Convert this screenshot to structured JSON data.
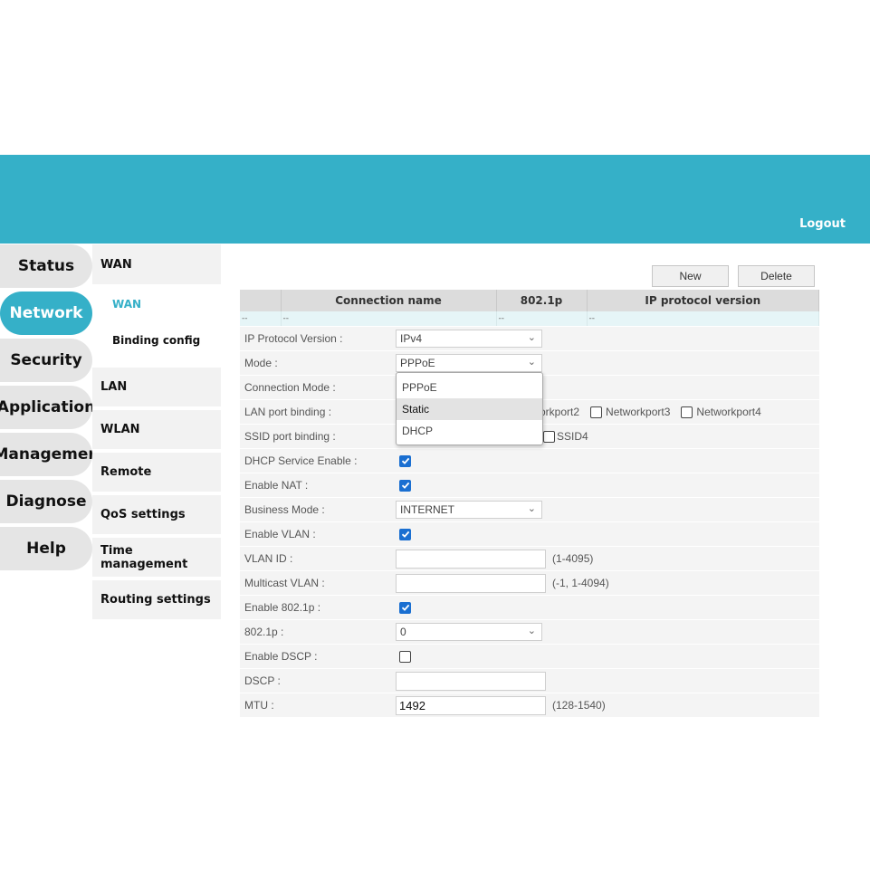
{
  "header": {
    "logout": "Logout"
  },
  "mainnav": [
    "Status",
    "Network",
    "Security",
    "Application",
    "Managemen",
    "Diagnose",
    "Help"
  ],
  "subnav": {
    "wan": "WAN",
    "wan_sub": [
      "WAN",
      "Binding config"
    ],
    "others": [
      "LAN",
      "WLAN",
      "Remote",
      "QoS settings",
      "Time management",
      "Routing settings"
    ]
  },
  "buttons": {
    "new": "New",
    "delete": "Delete"
  },
  "table": {
    "headers": [
      "",
      "Connection name",
      "802.1p",
      "IP protocol version"
    ],
    "row": [
      "--",
      "--",
      "--",
      "--"
    ]
  },
  "form": {
    "ip_protocol_label": "IP Protocol Version :",
    "ip_protocol_value": "IPv4",
    "mode_label": "Mode :",
    "mode_value": "PPPoE",
    "connection_mode_label": "Connection Mode :",
    "lan_binding_label": "LAN port binding :",
    "lan_ports": [
      "orkport2",
      "Networkport3",
      "Networkport4"
    ],
    "ssid_binding_label": "SSID port binding :",
    "ssid_port": "SSID4",
    "dhcp_label": "DHCP Service Enable :",
    "nat_label": "Enable NAT :",
    "business_mode_label": "Business Mode :",
    "business_mode_value": "INTERNET",
    "vlan_enable_label": "Enable VLAN :",
    "vlan_id_label": "VLAN ID :",
    "vlan_id_hint": "(1-4095)",
    "multicast_label": "Multicast VLAN :",
    "multicast_hint": "(-1, 1-4094)",
    "p8021_enable_label": "Enable 802.1p :",
    "p8021_label": "802.1p :",
    "p8021_value": "0",
    "dscp_enable_label": "Enable DSCP :",
    "dscp_label": "DSCP :",
    "mtu_label": "MTU :",
    "mtu_value": "1492",
    "mtu_hint": "(128-1540)"
  },
  "mode_options": [
    "PPPoE",
    "Static",
    "DHCP"
  ],
  "colors": {
    "accent": "#35b0c8",
    "checkbox": "#1a6fd1"
  }
}
